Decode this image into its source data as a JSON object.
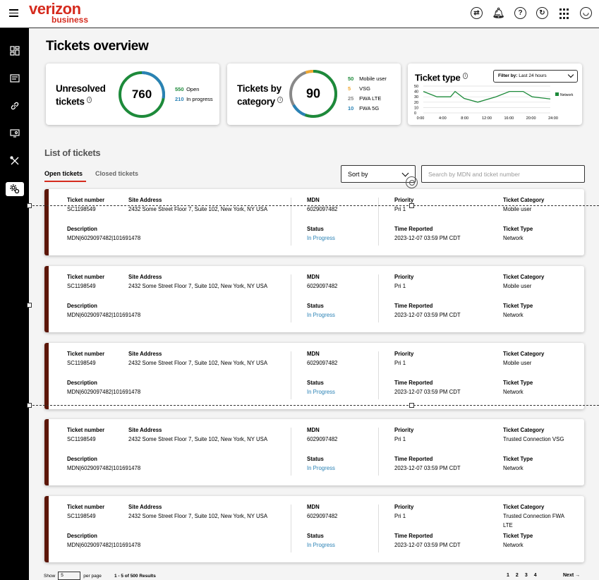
{
  "header": {
    "logo_main": "verizon",
    "logo_sub": "business",
    "icons": [
      "sync-icon",
      "bell-icon",
      "help-icon",
      "support-icon",
      "apps-grid-icon",
      "account-icon"
    ]
  },
  "sidebar": {
    "items": [
      "dashboard-icon",
      "billing-icon",
      "link-icon",
      "device-icon",
      "tools-icon",
      "settings-icon"
    ]
  },
  "page": {
    "title": "Tickets overview"
  },
  "cards": {
    "unresolved": {
      "title_line1": "Unresolved",
      "title_line2": "tickets",
      "total": "760",
      "open_count": "550",
      "open_label": "Open",
      "progress_count": "210",
      "progress_label": "In progress"
    },
    "category": {
      "title_line1": "Tickets by",
      "title_line2": "category",
      "total": "90",
      "items": [
        {
          "count": "50",
          "label": "Mobile user",
          "color": "#1d8a3a"
        },
        {
          "count": "5",
          "label": "VSG",
          "color": "#f0a830"
        },
        {
          "count": "25",
          "label": "FWA LTE",
          "color": "#888888"
        },
        {
          "count": "10",
          "label": "FWA 5G",
          "color": "#2a82b5"
        }
      ]
    },
    "type": {
      "title": "Ticket type",
      "filter_label": "Filter by:",
      "filter_value": "Last 24 hours",
      "legend": "Network"
    }
  },
  "chart_data": {
    "type": "line",
    "x": [
      "0:00",
      "4:00",
      "8:00",
      "12:00",
      "16:00",
      "20:00",
      "24:00"
    ],
    "series": [
      {
        "name": "Network",
        "values": [
          40,
          30,
          30,
          40,
          27,
          20,
          30,
          40,
          40,
          30,
          26
        ]
      }
    ],
    "point_x": [
      0,
      1.5,
      3,
      3.5,
      4.5,
      6,
      8,
      9.5,
      11,
      12,
      14
    ],
    "yticks": [
      "50",
      "40",
      "30",
      "20",
      "10",
      "0"
    ],
    "ylim": [
      0,
      50
    ],
    "grid": true,
    "legend": "right"
  },
  "list": {
    "title": "List of tickets",
    "tab_open": "Open tickets",
    "tab_closed": "Closed tickets",
    "sort_label": "Sort by",
    "search_placeholder": "Search by MDN and ticket number"
  },
  "labels": {
    "ticket_number": "Ticket number",
    "site_address": "Site Address",
    "mdn": "MDN",
    "priority": "Priority",
    "ticket_category": "Ticket Category",
    "description": "Description",
    "status": "Status",
    "time_reported": "Time Reported",
    "ticket_type": "Ticket  Type"
  },
  "tickets": [
    {
      "number": "SC1198549",
      "address": "2432 Some Street Floor 7, Suite 102, New York, NY USA",
      "mdn": "6029097482",
      "priority": "Pri 1",
      "category": "Mobile user",
      "description": "MDN|6029097482|101691478",
      "status": "In Progress",
      "time": "2023-12-07 03:59 PM CDT",
      "type": "Network"
    },
    {
      "number": "SC1198549",
      "address": "2432 Some Street Floor 7, Suite 102, New York, NY USA",
      "mdn": "6029097482",
      "priority": "Pri 1",
      "category": "Mobile user",
      "description": "MDN|6029097482|101691478",
      "status": "In Progress",
      "time": "2023-12-07 03:59 PM CDT",
      "type": "Network"
    },
    {
      "number": "SC1198549",
      "address": "2432 Some Street Floor 7, Suite 102, New York, NY USA",
      "mdn": "6029097482",
      "priority": "Pri 1",
      "category": "Mobile user",
      "description": "MDN|6029097482|101691478",
      "status": "In Progress",
      "time": "2023-12-07 03:59 PM CDT",
      "type": "Network"
    },
    {
      "number": "SC1198549",
      "address": "2432 Some Street Floor 7, Suite 102, New York, NY USA",
      "mdn": "6029097482",
      "priority": "Pri 1",
      "category": "Trusted Connection VSG",
      "description": "MDN|6029097482|101691478",
      "status": "In Progress",
      "time": "2023-12-07 03:59 PM CDT",
      "type": "Network"
    },
    {
      "number": "SC1198549",
      "address": "2432 Some Street Floor 7, Suite 102, New York, NY USA",
      "mdn": "6029097482",
      "priority": "Pri 1",
      "category": "Trusted Connection FWA LTE",
      "description": "MDN|6029097482|101691478",
      "status": "In Progress",
      "time": "2023-12-07 03:59 PM CDT",
      "type": "Network"
    }
  ],
  "footer": {
    "show_label": "Show",
    "per_page_value": "5",
    "per_page_label": "per page",
    "results": "1 - 5 of 500 Results",
    "pages": [
      "1",
      "2",
      "3",
      "4"
    ],
    "next": "Next"
  }
}
